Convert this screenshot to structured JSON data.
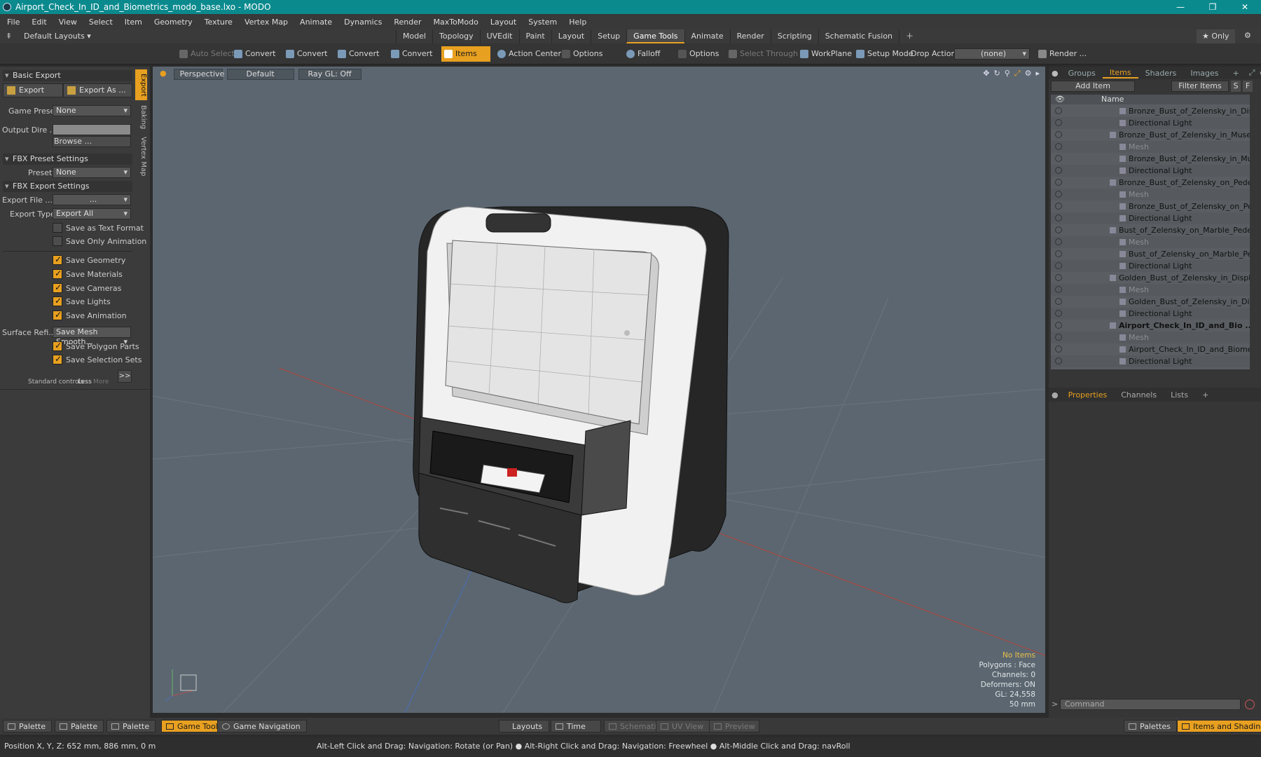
{
  "window": {
    "title": "Airport_Check_In_ID_and_Biometrics_modo_base.lxo - MODO"
  },
  "menu": [
    "File",
    "Edit",
    "View",
    "Select",
    "Item",
    "Geometry",
    "Texture",
    "Vertex Map",
    "Animate",
    "Dynamics",
    "Render",
    "MaxToModo",
    "Layout",
    "System",
    "Help"
  ],
  "layouts": {
    "label": "Default Layouts ▾",
    "only": "★ Only",
    "tabs": [
      "Model",
      "Topology",
      "UVEdit",
      "Paint",
      "Layout",
      "Setup",
      "Game Tools",
      "Animate",
      "Render",
      "Scripting",
      "Schematic Fusion"
    ],
    "active_tab": "Game Tools"
  },
  "toolbar": {
    "auto_select": "Auto Select",
    "convert1": "Convert",
    "convert2": "Convert",
    "convert3": "Convert",
    "convert4": "Convert",
    "items": "Items",
    "action_center": "Action Center",
    "options1": "Options",
    "falloff": "Falloff",
    "options2": "Options",
    "select_through": "Select Through",
    "workplane": "WorkPlane",
    "setup_mode": "Setup Mode",
    "drop_action": "Drop Action",
    "drop_value": "(none)",
    "render": "Render ..."
  },
  "left": {
    "vtabs": [
      "Export",
      "Baking",
      "Vertex Map"
    ],
    "basic_export": "Basic Export",
    "export": "Export",
    "export_as": "Export As ...",
    "game_preset_label": "Game Preset",
    "game_preset": "None",
    "output_dir_label": "Output Dire ...",
    "browse": "Browse ...",
    "fbx_preset_settings": "FBX Preset Settings",
    "preset_label": "Preset",
    "preset": "None",
    "fbx_export_settings": "FBX Export Settings",
    "export_file_label": "Export File ...",
    "export_file": "...",
    "export_type_label": "Export Type",
    "export_type": "Export All",
    "save_text": "Save as Text Format",
    "save_only_anim": "Save Only Animation",
    "save_geometry": "Save Geometry",
    "save_materials": "Save Materials",
    "save_cameras": "Save Cameras",
    "save_lights": "Save Lights",
    "save_animation": "Save Animation",
    "surface_label": "Surface Refi...",
    "surface": "Save Mesh Smooth...",
    "save_polygon_parts": "Save Polygon Parts",
    "save_selection_sets": "Save Selection Sets",
    "standard_controls": "Standard controls",
    "less": "Less",
    "more": "More",
    "arrow": ">>"
  },
  "viewport": {
    "perspective": "Perspective",
    "default": "Default",
    "raygl": "Ray GL: Off",
    "info": {
      "no_items": "No Items",
      "polygons": "Polygons : Face",
      "channels": "Channels: 0",
      "deformers": "Deformers: ON",
      "gl": "GL: 24,558",
      "mm": "50 mm"
    }
  },
  "right": {
    "tabs": [
      "Groups",
      "Items",
      "Shaders",
      "Images",
      "+"
    ],
    "active": "Items",
    "add_item": "Add Item",
    "filter_items": "Filter Items",
    "s": "S",
    "f": "F",
    "name_header": "Name",
    "items": [
      {
        "t": "Bronze_Bust_of_Zelensky_in_Dis ...",
        "lv": 2,
        "dim": false,
        "bold": false
      },
      {
        "t": "Directional Light",
        "lv": 2,
        "dim": false,
        "bold": false
      },
      {
        "t": "Bronze_Bust_of_Zelensky_in_Muse ...",
        "lv": 1,
        "dim": false,
        "bold": false
      },
      {
        "t": "Mesh",
        "lv": 2,
        "dim": true,
        "bold": false
      },
      {
        "t": "Bronze_Bust_of_Zelensky_in_Mu ...",
        "lv": 2,
        "dim": false,
        "bold": false
      },
      {
        "t": "Directional Light",
        "lv": 2,
        "dim": false,
        "bold": false
      },
      {
        "t": "Bronze_Bust_of_Zelensky_on_Pede ...",
        "lv": 1,
        "dim": false,
        "bold": false
      },
      {
        "t": "Mesh",
        "lv": 2,
        "dim": true,
        "bold": false
      },
      {
        "t": "Bronze_Bust_of_Zelensky_on_Pe ...",
        "lv": 2,
        "dim": false,
        "bold": false
      },
      {
        "t": "Directional Light",
        "lv": 2,
        "dim": false,
        "bold": false
      },
      {
        "t": "Bust_of_Zelensky_on_Marble_Pede ...",
        "lv": 1,
        "dim": false,
        "bold": false
      },
      {
        "t": "Mesh",
        "lv": 2,
        "dim": true,
        "bold": false
      },
      {
        "t": "Bust_of_Zelensky_on_Marble_Pe ...",
        "lv": 2,
        "dim": false,
        "bold": false
      },
      {
        "t": "Directional Light",
        "lv": 2,
        "dim": false,
        "bold": false
      },
      {
        "t": "Golden_Bust_of_Zelensky_in_Displa ...",
        "lv": 1,
        "dim": false,
        "bold": false
      },
      {
        "t": "Mesh",
        "lv": 2,
        "dim": true,
        "bold": false
      },
      {
        "t": "Golden_Bust_of_Zelensky_in_Dis ...",
        "lv": 2,
        "dim": false,
        "bold": false
      },
      {
        "t": "Directional Light",
        "lv": 2,
        "dim": false,
        "bold": false
      },
      {
        "t": "Airport_Check_In_ID_and_Bio ...",
        "lv": 1,
        "dim": false,
        "bold": true
      },
      {
        "t": "Mesh",
        "lv": 2,
        "dim": true,
        "bold": false
      },
      {
        "t": "Airport_Check_In_ID_and_Biome ...",
        "lv": 2,
        "dim": false,
        "bold": false
      },
      {
        "t": "Directional Light",
        "lv": 2,
        "dim": false,
        "bold": false
      }
    ],
    "props_tabs": [
      "Properties",
      "Channels",
      "Lists",
      "+"
    ],
    "command": "Command"
  },
  "bottom": {
    "palette1": "Palette",
    "palette2": "Palette",
    "palette3": "Palette",
    "game_tools": "Game Tools",
    "game_nav": "Game Navigation",
    "layouts": "Layouts",
    "time": "Time",
    "schematic": "Schematic",
    "uv_view": "UV View",
    "preview": "Preview",
    "palettes": "Palettes",
    "items_shading": "Items and Shading"
  },
  "status": {
    "position": "Position X, Y, Z:  652 mm, 886 mm, 0 m",
    "hint": "Alt-Left Click and Drag: Navigation: Rotate (or Pan) ● Alt-Right Click and Drag: Navigation: Freewheel ● Alt-Middle Click and Drag: navRoll"
  }
}
